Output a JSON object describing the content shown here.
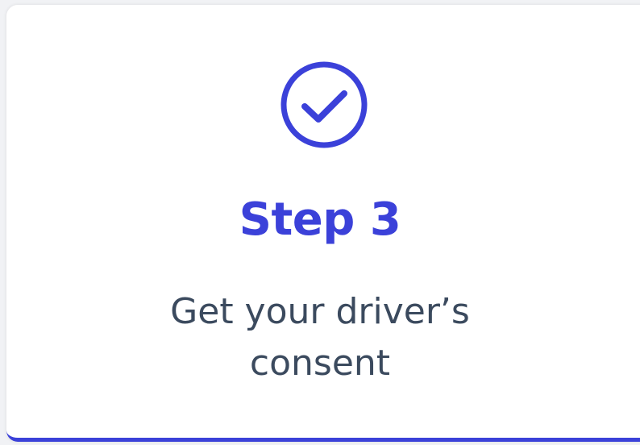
{
  "step": {
    "icon": "check-circle-icon",
    "title": "Step 3",
    "description_lines": [
      "Get your driver’s",
      "consent"
    ]
  },
  "colors": {
    "accent": "#3b41d9",
    "text": "#3b4a5e",
    "background": "#ffffff"
  }
}
